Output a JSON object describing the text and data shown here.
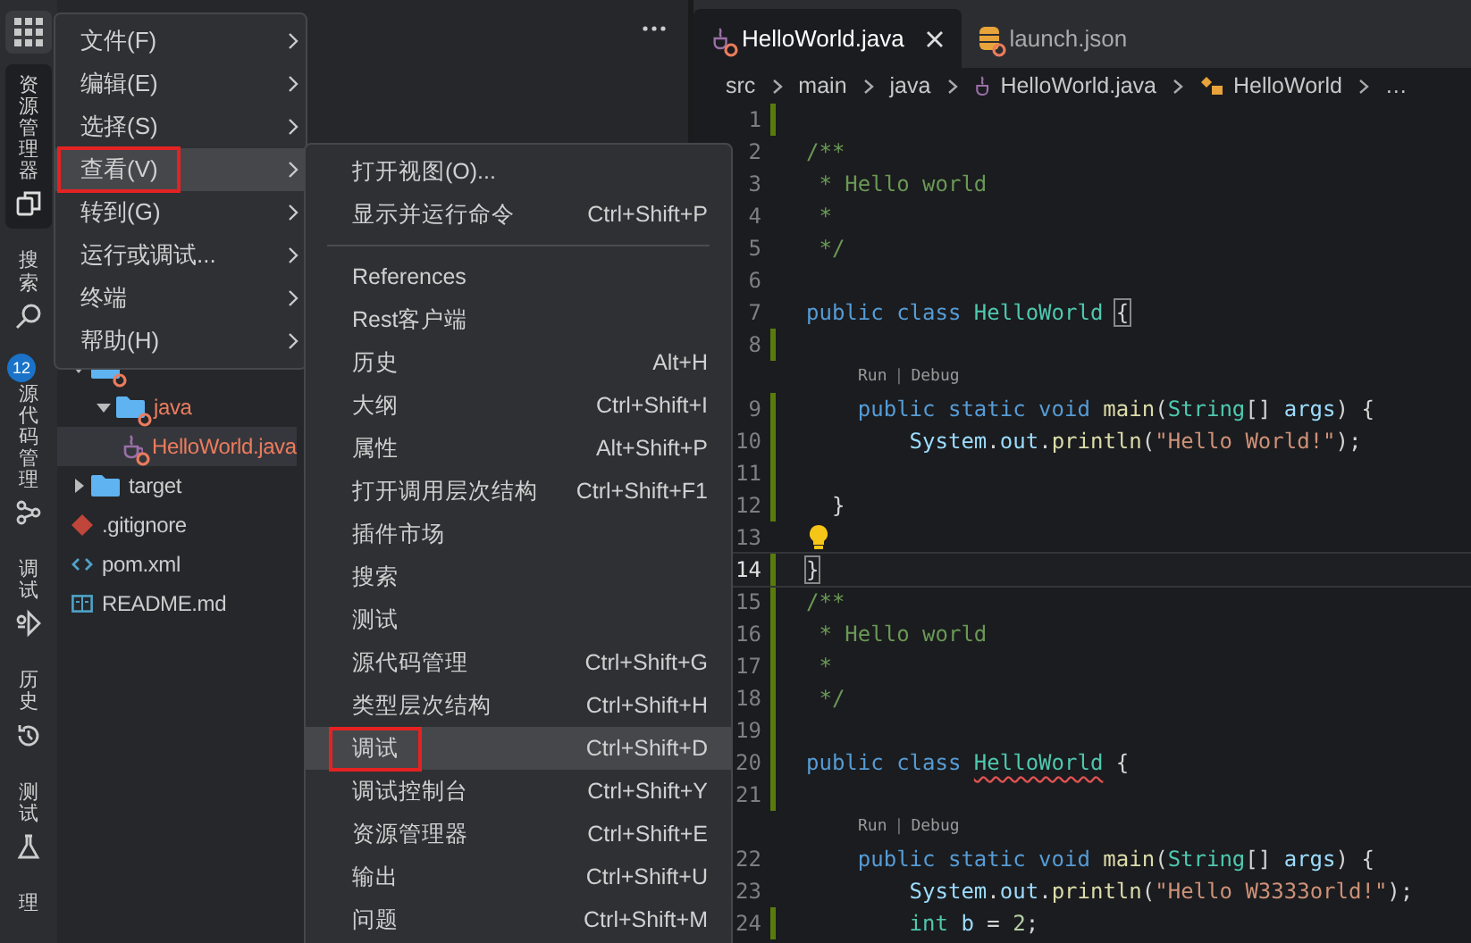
{
  "activity_bar": [
    {
      "label": "资源管理器",
      "kind": "explorer",
      "selected": true
    },
    {
      "label": "搜索",
      "kind": "search",
      "selected": false
    },
    {
      "label": "源代码管理",
      "kind": "scm",
      "selected": false,
      "badge": "12"
    },
    {
      "label": "调试",
      "kind": "debug",
      "selected": false
    },
    {
      "label": "历史",
      "kind": "history",
      "selected": false
    },
    {
      "label": "测试",
      "kind": "test",
      "selected": false
    },
    {
      "label": "理",
      "kind": "manage",
      "selected": false
    }
  ],
  "explorer": {
    "items": [
      {
        "kind": "folder",
        "error": true,
        "expanded": true,
        "selected": false,
        "children": [
          {
            "name": "java",
            "kind": "folder",
            "error": true,
            "expanded": true,
            "selected": false,
            "children": [
              {
                "name": "HelloWorld.java",
                "kind": "java",
                "error": true,
                "selected": true
              }
            ]
          }
        ]
      },
      {
        "name": "target",
        "kind": "folder",
        "error": false,
        "expanded": false,
        "selected": false
      },
      {
        "name": ".gitignore",
        "kind": "git",
        "error": false,
        "selected": false
      },
      {
        "name": "pom.xml",
        "kind": "xml",
        "error": false,
        "selected": false
      },
      {
        "name": "README.md",
        "kind": "md",
        "error": false,
        "selected": false
      }
    ]
  },
  "menu": {
    "items": [
      {
        "label": "文件(F)",
        "selected": false
      },
      {
        "label": "编辑(E)",
        "selected": false
      },
      {
        "label": "选择(S)",
        "selected": false
      },
      {
        "label": "查看(V)",
        "selected": true
      },
      {
        "label": "转到(G)",
        "selected": false
      },
      {
        "label": "运行或调试...",
        "selected": false
      },
      {
        "label": "终端",
        "selected": false
      },
      {
        "label": "帮助(H)",
        "selected": false
      }
    ]
  },
  "submenu": {
    "groups": [
      [
        {
          "label": "打开视图(O)...",
          "selected": false
        },
        {
          "label": "显示并运行命令",
          "shortcut": "Ctrl+Shift+P",
          "selected": false
        }
      ],
      [
        {
          "label": "References",
          "selected": false
        },
        {
          "label": "Rest客户端",
          "selected": false
        },
        {
          "label": "历史",
          "shortcut": "Alt+H",
          "selected": false
        },
        {
          "label": "大纲",
          "shortcut": "Ctrl+Shift+I",
          "selected": false
        },
        {
          "label": "属性",
          "shortcut": "Alt+Shift+P",
          "selected": false
        },
        {
          "label": "打开调用层次结构",
          "shortcut": "Ctrl+Shift+F1",
          "selected": false
        },
        {
          "label": "插件市场",
          "selected": false
        },
        {
          "label": "搜索",
          "selected": false
        },
        {
          "label": "测试",
          "selected": false
        },
        {
          "label": "源代码管理",
          "shortcut": "Ctrl+Shift+G",
          "selected": false
        },
        {
          "label": "类型层次结构",
          "shortcut": "Ctrl+Shift+H",
          "selected": false
        },
        {
          "label": "调试",
          "shortcut": "Ctrl+Shift+D",
          "selected": true
        },
        {
          "label": "调试控制台",
          "shortcut": "Ctrl+Shift+Y",
          "selected": false
        },
        {
          "label": "资源管理器",
          "shortcut": "Ctrl+Shift+E",
          "selected": false
        },
        {
          "label": "输出",
          "shortcut": "Ctrl+Shift+U",
          "selected": false
        },
        {
          "label": "问题",
          "shortcut": "Ctrl+Shift+M",
          "selected": false
        }
      ]
    ]
  },
  "tabs": [
    {
      "label": "HelloWorld.java",
      "kind": "java",
      "selected": true
    },
    {
      "label": "launch.json",
      "kind": "json",
      "selected": false
    }
  ],
  "breadcrumb": [
    {
      "text": "src",
      "kind": "folder"
    },
    {
      "text": "main",
      "kind": "folder"
    },
    {
      "text": "java",
      "kind": "folder"
    },
    {
      "text": "HelloWorld.java",
      "kind": "java"
    },
    {
      "text": "HelloWorld",
      "kind": "class"
    },
    {
      "text": "…",
      "kind": "more"
    }
  ],
  "code": [
    {
      "kind": "code",
      "number": "1",
      "changed": true,
      "current": false
    },
    {
      "kind": "code",
      "number": "2",
      "changed": false,
      "current": false,
      "lightbulb": false,
      "tokens": [
        {
          "kind": "com",
          "text": "/**"
        }
      ]
    },
    {
      "kind": "code",
      "number": "3",
      "changed": false,
      "current": false,
      "lightbulb": false,
      "tokens": [
        {
          "kind": "com",
          "text": " * Hello world"
        }
      ]
    },
    {
      "kind": "code",
      "number": "4",
      "changed": false,
      "current": false,
      "lightbulb": false,
      "tokens": [
        {
          "kind": "com",
          "text": " *"
        }
      ]
    },
    {
      "kind": "code",
      "number": "5",
      "changed": false,
      "current": false,
      "lightbulb": false,
      "tokens": [
        {
          "kind": "com",
          "text": " */"
        }
      ]
    },
    {
      "kind": "code",
      "number": "6",
      "changed": false,
      "current": false
    },
    {
      "kind": "code",
      "number": "7",
      "changed": false,
      "current": false,
      "lightbulb": false,
      "tokens": [
        {
          "kind": "kw",
          "text": "public class"
        },
        {
          "kind": "cls",
          "text": " HelloWorld "
        },
        {
          "kind": "match",
          "text": "{"
        }
      ]
    },
    {
      "kind": "code",
      "number": "8",
      "changed": true,
      "current": false
    },
    {
      "kind": "codelens",
      "links": [
        "Run",
        "Debug"
      ],
      "separator": "|"
    },
    {
      "kind": "code",
      "number": "9",
      "changed": true,
      "current": false,
      "lightbulb": false,
      "tokens": [
        {
          "kind": "kw",
          "text": "    public static void"
        },
        {
          "kind": "fn",
          "text": " main"
        },
        {
          "kind": "pun",
          "text": "("
        },
        {
          "kind": "cls",
          "text": "String"
        },
        {
          "kind": "pun",
          "text": "[] "
        },
        {
          "kind": "var",
          "text": "args"
        },
        {
          "kind": "pun",
          "text": ") {"
        }
      ]
    },
    {
      "kind": "code",
      "number": "10",
      "changed": true,
      "current": false,
      "lightbulb": false,
      "tokens": [
        {
          "kind": "var",
          "text": "        System"
        },
        {
          "kind": "pun",
          "text": "."
        },
        {
          "kind": "var",
          "text": "out"
        },
        {
          "kind": "pun",
          "text": "."
        },
        {
          "kind": "fn",
          "text": "println"
        },
        {
          "kind": "pun",
          "text": "("
        },
        {
          "kind": "str",
          "text": "\"Hello World!\""
        },
        {
          "kind": "pun",
          "text": ");"
        }
      ]
    },
    {
      "kind": "code",
      "number": "11",
      "changed": true,
      "current": false
    },
    {
      "kind": "code",
      "number": "12",
      "changed": true,
      "current": false,
      "lightbulb": false,
      "tokens": [
        {
          "kind": "pun",
          "text": "  }"
        }
      ]
    },
    {
      "kind": "code",
      "number": "13",
      "changed": false,
      "current": false,
      "lightbulb": true
    },
    {
      "kind": "code",
      "number": "14",
      "changed": true,
      "current": true,
      "lightbulb": false,
      "tokens": [
        {
          "kind": "match",
          "text": "}"
        }
      ]
    },
    {
      "kind": "code",
      "number": "15",
      "changed": true,
      "current": false,
      "lightbulb": false,
      "tokens": [
        {
          "kind": "com",
          "text": "/**"
        }
      ]
    },
    {
      "kind": "code",
      "number": "16",
      "changed": true,
      "current": false,
      "lightbulb": false,
      "tokens": [
        {
          "kind": "com",
          "text": " * Hello world"
        }
      ]
    },
    {
      "kind": "code",
      "number": "17",
      "changed": true,
      "current": false,
      "lightbulb": false,
      "tokens": [
        {
          "kind": "com",
          "text": " *"
        }
      ]
    },
    {
      "kind": "code",
      "number": "18",
      "changed": true,
      "current": false,
      "lightbulb": false,
      "tokens": [
        {
          "kind": "com",
          "text": " */"
        }
      ]
    },
    {
      "kind": "code",
      "number": "19",
      "changed": true,
      "current": false
    },
    {
      "kind": "code",
      "number": "20",
      "changed": true,
      "current": false,
      "lightbulb": false,
      "tokens": [
        {
          "kind": "kw",
          "text": "public class "
        },
        {
          "kind": "err",
          "text": "HelloWorld"
        },
        {
          "kind": "pun",
          "text": " {"
        }
      ]
    },
    {
      "kind": "code",
      "number": "21",
      "changed": true,
      "current": false
    },
    {
      "kind": "codelens",
      "links": [
        "Run",
        "Debug"
      ],
      "separator": "|"
    },
    {
      "kind": "code",
      "number": "22",
      "changed": false,
      "current": false,
      "lightbulb": false,
      "tokens": [
        {
          "kind": "kw",
          "text": "    public static void"
        },
        {
          "kind": "fn",
          "text": " main"
        },
        {
          "kind": "pun",
          "text": "("
        },
        {
          "kind": "cls",
          "text": "String"
        },
        {
          "kind": "pun",
          "text": "[] "
        },
        {
          "kind": "var",
          "text": "args"
        },
        {
          "kind": "pun",
          "text": ") {"
        }
      ]
    },
    {
      "kind": "code",
      "number": "23",
      "changed": false,
      "current": false,
      "lightbulb": false,
      "tokens": [
        {
          "kind": "var",
          "text": "        System"
        },
        {
          "kind": "pun",
          "text": "."
        },
        {
          "kind": "var",
          "text": "out"
        },
        {
          "kind": "pun",
          "text": "."
        },
        {
          "kind": "fn",
          "text": "println"
        },
        {
          "kind": "pun",
          "text": "("
        },
        {
          "kind": "str",
          "text": "\"Hello W3333orld!\""
        },
        {
          "kind": "pun",
          "text": ");"
        }
      ]
    },
    {
      "kind": "code",
      "number": "24",
      "changed": true,
      "current": false,
      "lightbulb": false,
      "tokens": [
        {
          "kind": "cls",
          "text": "        int"
        },
        {
          "kind": "var",
          "text": " b"
        },
        {
          "kind": "pun",
          "text": " = "
        },
        {
          "kind": "num",
          "text": "2"
        },
        {
          "kind": "pun",
          "text": ";"
        }
      ]
    }
  ]
}
